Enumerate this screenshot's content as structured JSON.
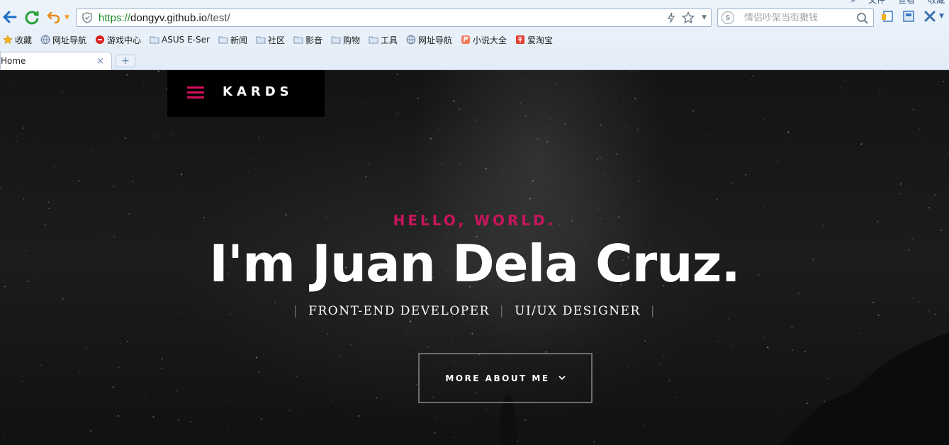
{
  "browser": {
    "menu": [
      "»",
      "文件",
      "查看",
      "收藏"
    ],
    "url": {
      "scheme": "https://",
      "host": "dongyv.github.io",
      "path": "/test/"
    },
    "search_placeholder": "情侣吵架当街撒钱",
    "bookmarks": [
      {
        "label": "收藏",
        "icon": "star-icon"
      },
      {
        "label": "网址导航",
        "icon": "globe-icon"
      },
      {
        "label": "游戏中心",
        "icon": "game-icon"
      },
      {
        "label": "ASUS E-Ser",
        "icon": "folder-icon"
      },
      {
        "label": "新闻",
        "icon": "folder-icon"
      },
      {
        "label": "社区",
        "icon": "folder-icon"
      },
      {
        "label": "影音",
        "icon": "folder-icon"
      },
      {
        "label": "购物",
        "icon": "folder-icon"
      },
      {
        "label": "工具",
        "icon": "folder-icon"
      },
      {
        "label": "网址导航",
        "icon": "globe-icon"
      },
      {
        "label": "小说大全",
        "icon": "book-icon"
      },
      {
        "label": "爱淘宝",
        "icon": "taobao-icon"
      }
    ],
    "tab_title": "Home",
    "new_tab_label": "+",
    "close_tab_glyph": "×"
  },
  "page": {
    "logo": "KARDS",
    "greeting": "HELLO, WORLD.",
    "headline": "I'm Juan Dela Cruz.",
    "roles": [
      "FRONT-END DEVELOPER",
      "UI/UX DESIGNER"
    ],
    "separator": "|",
    "cta_label": "MORE ABOUT ME",
    "cta_icon": "chevron-down-icon"
  },
  "colors": {
    "accent": "#d3105e",
    "background": "#151515",
    "text": "#ffffff",
    "url_green": "#1f8b2d"
  }
}
